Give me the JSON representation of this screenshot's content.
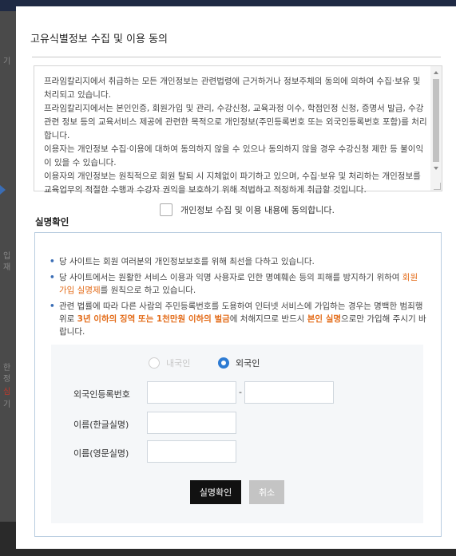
{
  "background": {
    "left_fragments": [
      "기",
      "입",
      "재",
      "한",
      "정",
      "심",
      "기"
    ]
  },
  "modal": {
    "title": "고유식별정보 수집 및 이용 동의",
    "terms": [
      "프라임칼리지에서 취급하는 모든 개인정보는 관련법령에 근거하거나 정보주체의 동의에 의하여 수집·보유 및 처리되고 있습니다.",
      "프라임칼리지에서는 본인인증, 회원가입 및 관리, 수강신청, 교육과정 이수, 학점인정 신청, 증명서 발급, 수강관련 정보 등의 교육서비스 제공에 관련한 목적으로 개인정보(주민등록번호 또는 외국인등록번호 포함)를 처리합니다.",
      "이용자는 개인정보 수집·이용에 대하여 동의하지 않을 수 있으나 동의하지 않을 경우 수강신청 제한 등 불이익이 있을 수 있습니다.",
      "이용자의 개인정보는 원칙적으로 회원 탈퇴 시 지체없이 파기하고 있으며, 수집·보유 및 처리하는 개인정보를 교육업무의 적절한 수행과 수강자 권익을 보호하기 위해 적법하고 적정하게 취급할 것입니다."
    ],
    "agree_label": "개인정보 수집 및 이용 내용에 동의합니다.",
    "agree_checked": false,
    "section_title": "실명확인",
    "notices": {
      "n1": "당 사이트는 회원 여러분의 개인정보보호를 위해 최선을 다하고 있습니다.",
      "n2_pre": "당 사이트에서는 원활한 서비스 이용과 익명 사용자로 인한 명예훼손 등의 피해를 방지하기 위하여 ",
      "n2_hl": "회원 가입 실명제",
      "n2_post": "를 원칙으로 하고 있습니다.",
      "n3_pre": "관련 법률에 따라 다른 사람의 주민등록번호를 도용하여 인터넷 서비스에 가입하는 경우는 명백한 범죄행위로 ",
      "n3_hl1": "3년 이하의 징역 또는 1천만원 이하의 벌금",
      "n3_mid": "에 처해지므로 반드시 ",
      "n3_hl2": "본인 실명",
      "n3_post": "으로만 가입해 주시기 바랍니다."
    },
    "form": {
      "radio_domestic": "내국인",
      "radio_foreign": "외국인",
      "selected": "외국인",
      "label_reg_no": "외국인등록번호",
      "reg_no_part1": "",
      "reg_no_part2": "",
      "dash": "-",
      "label_name_kr": "이름(한글실명)",
      "name_kr": "",
      "label_name_en": "이름(영문실명)",
      "name_en": "",
      "submit_label": "실명확인",
      "cancel_label": "취소"
    }
  },
  "colors": {
    "accent": "#2d7bd3",
    "highlight": "#e36b18",
    "primary_button": "#111111",
    "cancel_button": "#c4c4c4",
    "box_border": "#b9cde0"
  },
  "icons": {
    "close": "close-icon",
    "checkbox": "checkbox-icon"
  }
}
